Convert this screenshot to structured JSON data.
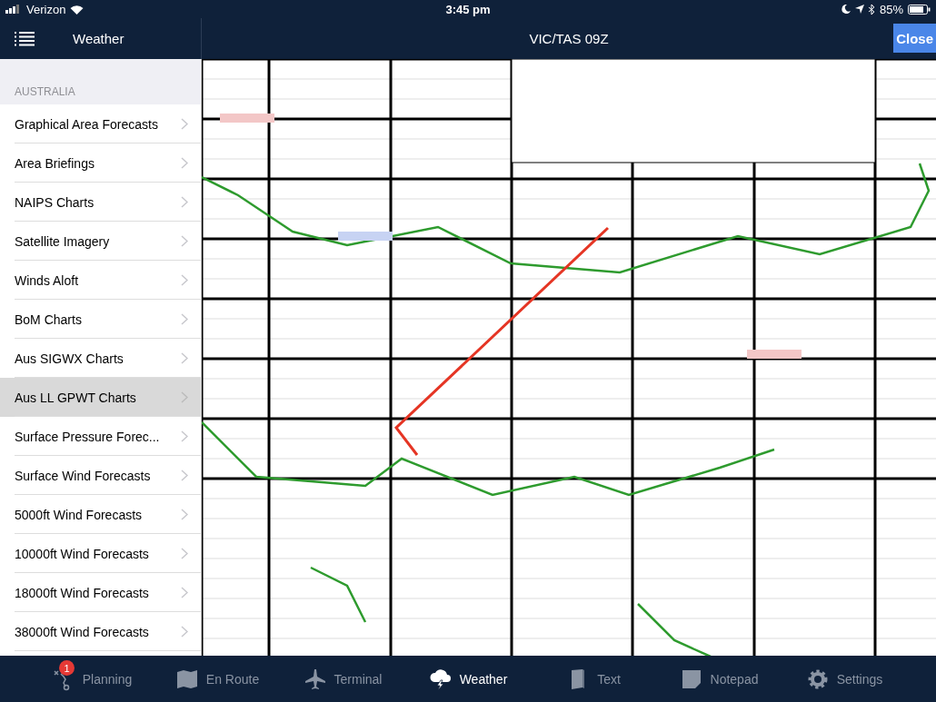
{
  "status_bar": {
    "carrier": "Verizon",
    "time": "3:45 pm",
    "battery": "85%"
  },
  "sidebar": {
    "title": "Weather",
    "section": "AUSTRALIA",
    "items": [
      {
        "label": "Graphical Area Forecasts",
        "selected": false
      },
      {
        "label": "Area Briefings",
        "selected": false
      },
      {
        "label": "NAIPS Charts",
        "selected": false
      },
      {
        "label": "Satellite Imagery",
        "selected": false
      },
      {
        "label": "Winds Aloft",
        "selected": false
      },
      {
        "label": "BoM Charts",
        "selected": false
      },
      {
        "label": "Aus SIGWX Charts",
        "selected": false
      },
      {
        "label": "Aus LL GPWT Charts",
        "selected": true
      },
      {
        "label": "Surface Pressure Forec...",
        "selected": false
      },
      {
        "label": "Surface Wind Forecasts",
        "selected": false
      },
      {
        "label": "5000ft Wind Forecasts",
        "selected": false
      },
      {
        "label": "10000ft Wind Forecasts",
        "selected": false
      },
      {
        "label": "18000ft Wind Forecasts",
        "selected": false
      },
      {
        "label": "38000ft Wind Forecasts",
        "selected": false
      }
    ]
  },
  "detail": {
    "title": "VIC/TAS 09Z",
    "close": "Close"
  },
  "tab_bar": [
    {
      "kind": "planning",
      "label": "Planning",
      "badge": "1",
      "selected": false
    },
    {
      "kind": "enroute",
      "label": "En Route",
      "selected": false
    },
    {
      "kind": "terminal",
      "label": "Terminal",
      "selected": false
    },
    {
      "kind": "weather",
      "label": "Weather",
      "selected": true
    },
    {
      "kind": "text",
      "label": "Text",
      "selected": false
    },
    {
      "kind": "notepad",
      "label": "Notepad",
      "selected": false
    },
    {
      "kind": "settings",
      "label": "Settings",
      "selected": false
    }
  ]
}
